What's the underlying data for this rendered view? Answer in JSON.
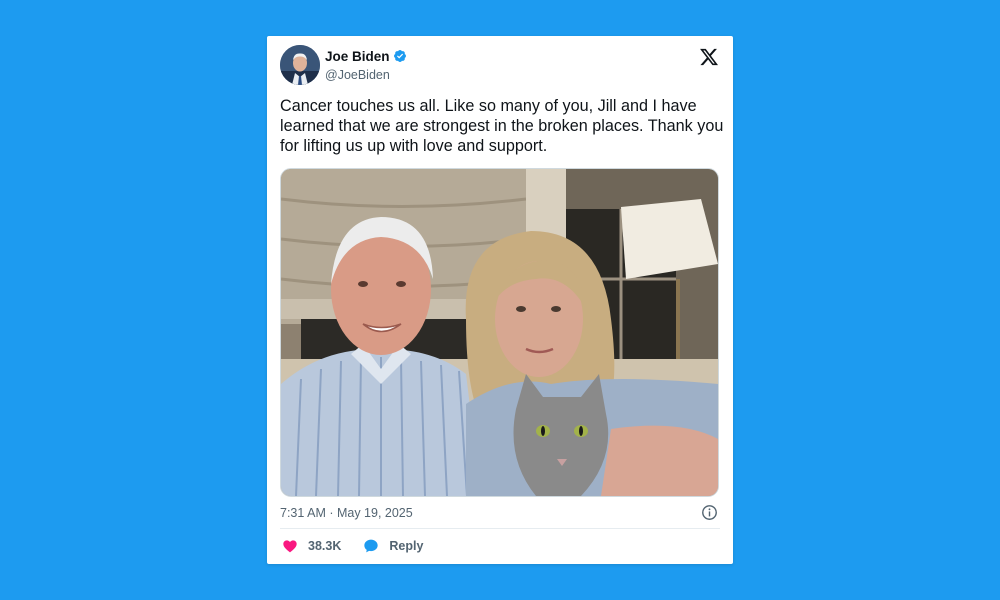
{
  "tweet": {
    "author": {
      "name": "Joe Biden",
      "handle": "@JoeBiden",
      "verified": true,
      "avatar_icon": "profile-photo"
    },
    "platform_icon": "x-logo-icon",
    "text": "Cancer touches us all. Like so many of you, Jill and I have learned that we are strongest in the broken places. Thank you for lifting us up with love and support.",
    "timestamp": "7:31 AM · May 19, 2025",
    "likes": "38.3K",
    "reply_label": "Reply"
  },
  "colors": {
    "background": "#1d9bf0",
    "verified": "#1d9bf0",
    "like": "#f91880",
    "reply": "#1d9bf0",
    "secondary_text": "#536471"
  }
}
